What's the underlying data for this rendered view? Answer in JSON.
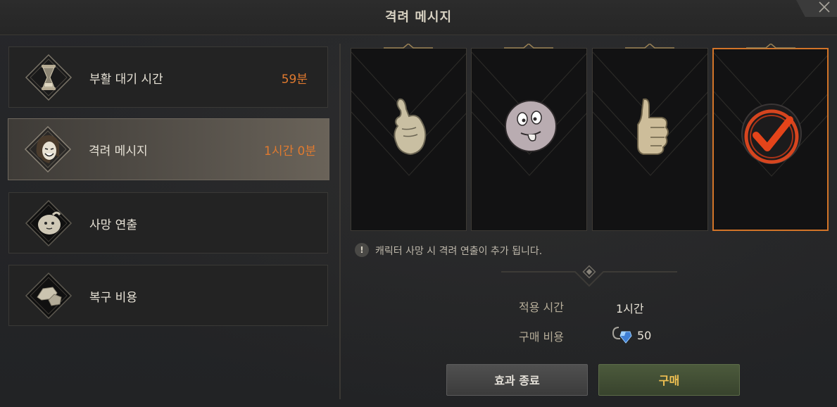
{
  "window": {
    "title": "격려 메시지",
    "close_icon": "close-icon"
  },
  "menu": {
    "items": [
      {
        "label": "부활 대기 시간",
        "value": "59분",
        "icon": "hourglass-icon"
      },
      {
        "label": "격려 메시지",
        "value": "1시간 0분",
        "icon": "cheer-character-icon",
        "selected": true
      },
      {
        "label": "사망 연출",
        "value": "",
        "icon": "ghost-icon"
      },
      {
        "label": "복구 비용",
        "value": "",
        "icon": "rocks-icon"
      }
    ]
  },
  "cards": [
    {
      "icon": "finger-heart-icon"
    },
    {
      "icon": "tongue-face-icon"
    },
    {
      "icon": "thumbs-up-icon"
    },
    {
      "icon": "checkmark-badge-icon",
      "selected": true
    }
  ],
  "notice": {
    "icon": "exclamation-icon",
    "icon_text": "!",
    "text": "캐릭터 사망 시 격려 연출이 추가 됩니다."
  },
  "details": {
    "duration_label": "적용 시간",
    "duration_value": "1시간",
    "cost_label": "구매 비용",
    "cost_icon": "gem-currency-icon",
    "cost_value": "50"
  },
  "buttons": {
    "end_effect": "효과 종료",
    "buy": "구매"
  },
  "colors": {
    "accent_orange": "#e07a2f",
    "buy_text": "#f0c052",
    "selected_border": "#d27428"
  }
}
